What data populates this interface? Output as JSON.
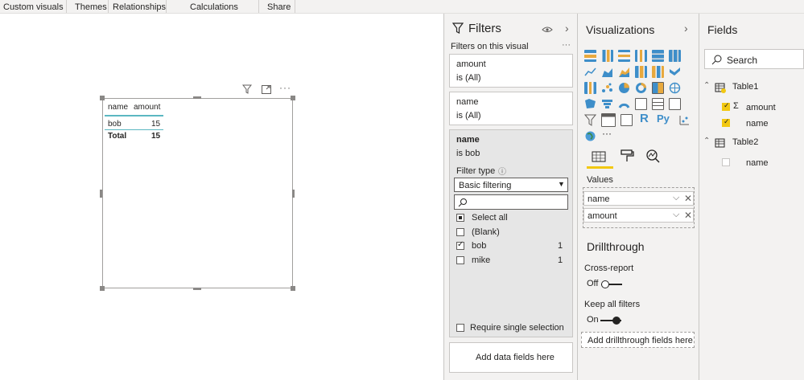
{
  "ribbon": {
    "tabs": [
      "Custom visuals",
      "Themes",
      "Relationships",
      "Calculations",
      "Share"
    ]
  },
  "visual": {
    "columns": [
      "name",
      "amount"
    ],
    "rows": [
      {
        "name": "bob",
        "amount": "15"
      }
    ],
    "total": {
      "label": "Total",
      "amount": "15"
    }
  },
  "filters": {
    "title": "Filters",
    "on_visual": "Filters on this visual",
    "more": "···",
    "cards": [
      {
        "field": "amount",
        "state": "is (All)"
      },
      {
        "field": "name",
        "state": "is (All)"
      }
    ],
    "active": {
      "field": "name",
      "state": "is bob",
      "filter_type_label": "Filter type",
      "filter_type_value": "Basic filtering",
      "search_placeholder": "",
      "items": [
        {
          "label": "Select all",
          "count": "",
          "state": "partial"
        },
        {
          "label": "(Blank)",
          "count": "",
          "state": "off"
        },
        {
          "label": "bob",
          "count": "1",
          "state": "on"
        },
        {
          "label": "mike",
          "count": "1",
          "state": "off"
        }
      ],
      "require_single": "Require single selection"
    },
    "add_fields": "Add data fields here"
  },
  "visualizations": {
    "title": "Visualizations",
    "values_label": "Values",
    "wells": [
      "name",
      "amount"
    ],
    "drillthrough_title": "Drillthrough",
    "cross_report": "Cross-report",
    "cross_state": "Off",
    "keep_filters": "Keep all filters",
    "keep_state": "On",
    "add_drill": "Add drillthrough fields here",
    "icon_letters": {
      "r": "R",
      "py": "Py"
    },
    "more": "···"
  },
  "fields": {
    "title": "Fields",
    "search_placeholder": "Search",
    "tables": [
      {
        "name": "Table1",
        "fields": [
          {
            "label": "amount",
            "sigma": "Σ",
            "checked": true
          },
          {
            "label": "name",
            "checked": true
          }
        ]
      },
      {
        "name": "Table2",
        "fields": [
          {
            "label": "name",
            "checked": false
          }
        ]
      }
    ]
  },
  "colors": {
    "accent_yellow": "#f2c811",
    "table_rule": "#5bb7c2",
    "viz_blue": "#3e8ec9",
    "viz_orange": "#e8a93e"
  }
}
